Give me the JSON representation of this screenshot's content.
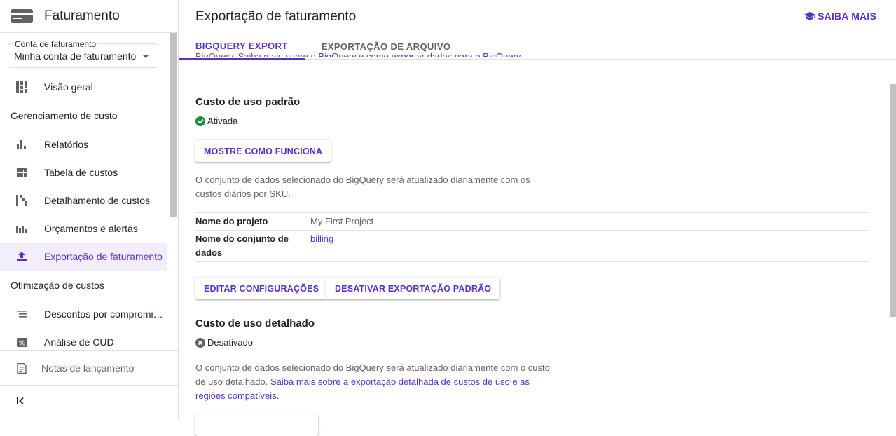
{
  "sidebar": {
    "title": "Faturamento",
    "account": {
      "label": "Conta de faturamento",
      "value": "Minha conta de faturamento"
    },
    "items": [
      {
        "type": "item",
        "label": "Visão geral",
        "icon": "dashboard-icon"
      },
      {
        "type": "section",
        "label": "Gerenciamento de custo"
      },
      {
        "type": "item",
        "label": "Relatórios",
        "icon": "bar-chart-icon"
      },
      {
        "type": "item",
        "label": "Tabela de custos",
        "icon": "table-icon"
      },
      {
        "type": "item",
        "label": "Detalhamento de custos",
        "icon": "breakdown-icon"
      },
      {
        "type": "item",
        "label": "Orçamentos e alertas",
        "icon": "budget-icon"
      },
      {
        "type": "item",
        "label": "Exportação de faturamento",
        "icon": "upload-icon",
        "active": true
      },
      {
        "type": "section",
        "label": "Otimização de custos"
      },
      {
        "type": "item",
        "label": "Descontos por compromi…",
        "icon": "list-icon"
      },
      {
        "type": "item",
        "label": "Análise de CUD",
        "icon": "percent-icon"
      }
    ],
    "footer": {
      "release_notes": "Notas de lançamento"
    }
  },
  "header": {
    "title": "Exportação de faturamento",
    "learn_more": "SAIBA MAIS"
  },
  "tabs": [
    {
      "label": "BIGQUERY EXPORT",
      "active": true
    },
    {
      "label": "EXPORTAÇÃO DE ARQUIVO",
      "active": false
    }
  ],
  "intro": {
    "prefix": "BigQuery. Saiba mais sobre o ",
    "link1": "BigQuery",
    "middle": " e ",
    "link2": "como exportar dados para o BigQuery"
  },
  "standard": {
    "title": "Custo de uso padrão",
    "status": "Ativada",
    "show_button": "MOSTRE COMO FUNCIONA",
    "description": "O conjunto de dados selecionado do BigQuery será atualizado diariamente com os custos diários por SKU.",
    "rows": [
      {
        "key": "Nome do projeto",
        "value": "My First Project",
        "link": false
      },
      {
        "key": "Nome do conjunto de dados",
        "value": "billing",
        "link": true
      }
    ],
    "edit_button": "EDITAR CONFIGURAÇÕES",
    "disable_button": "DESATIVAR EXPORTAÇÃO PADRÃO"
  },
  "detailed": {
    "title": "Custo de uso detalhado",
    "status": "Desativado",
    "description": "O conjunto de dados selecionado do BigQuery será atualizado diariamente com o custo de uso detalhado. ",
    "link": "Saiba mais sobre a exportação detalhada de custos de uso e as regiões compatíveis."
  },
  "colors": {
    "accent": "#5b2fc9",
    "success": "#1e8e3e",
    "disabled": "#5f6368"
  }
}
